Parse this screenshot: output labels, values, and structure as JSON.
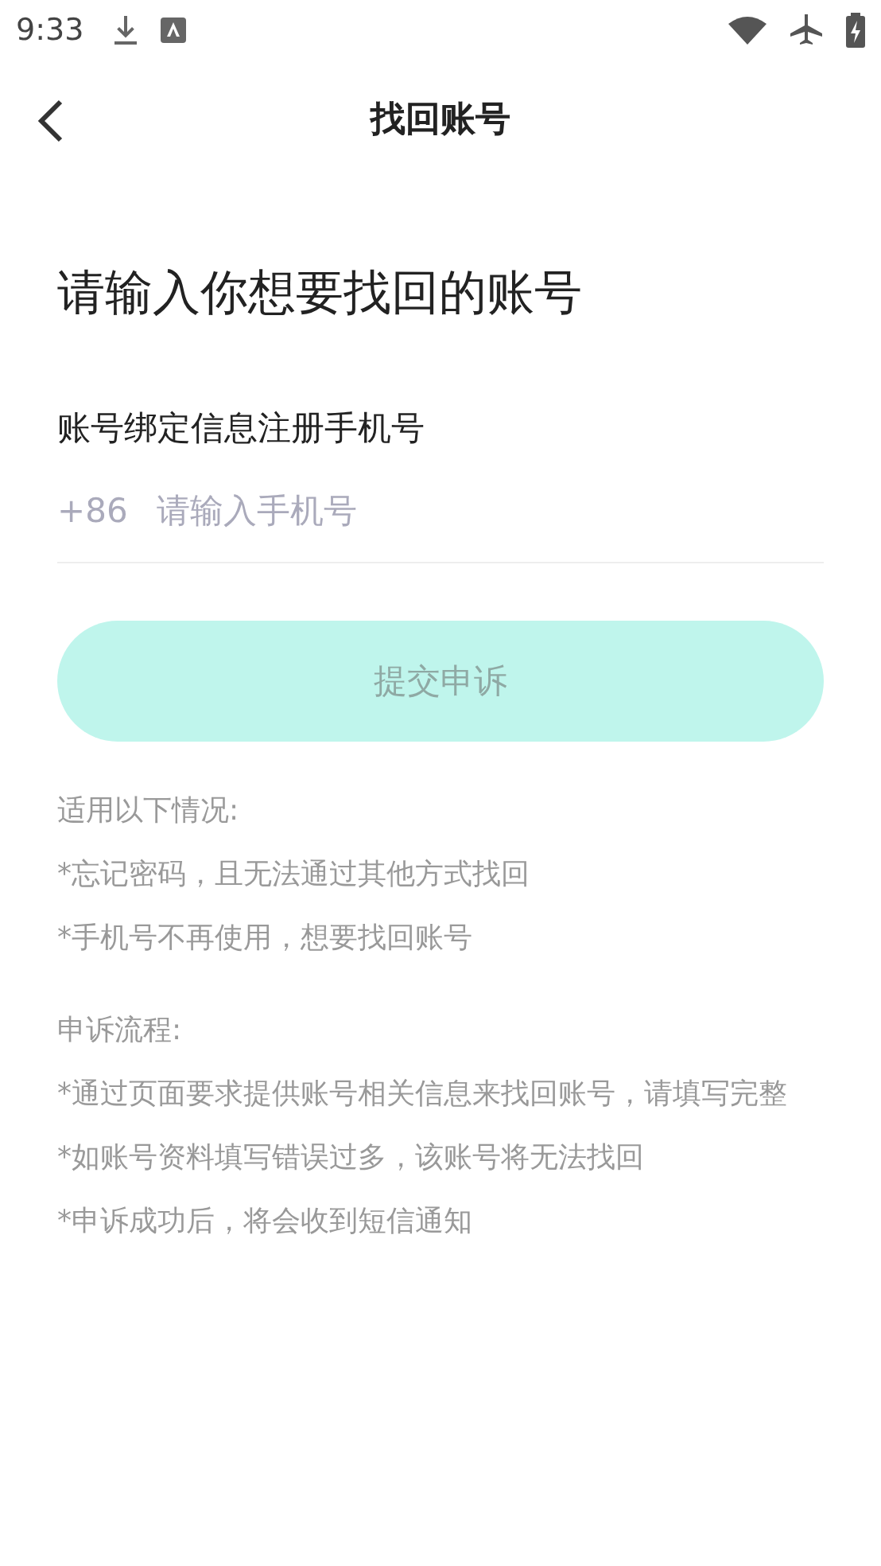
{
  "status_bar": {
    "time": "9:33"
  },
  "header": {
    "title": "找回账号"
  },
  "heading": "请输入你想要找回的账号",
  "phone_field": {
    "label": "账号绑定信息注册手机号",
    "country_code": "+86",
    "placeholder": "请输入手机号"
  },
  "submit_button": {
    "label": "提交申诉",
    "disabled": true
  },
  "notes": [
    {
      "title": "适用以下情况:",
      "items": [
        "*忘记密码，且无法通过其他方式找回",
        "*手机号不再使用，想要找回账号"
      ]
    },
    {
      "title": "申诉流程:",
      "items": [
        "*通过页面要求提供账号相关信息来找回账号，请填写完整",
        "*如账号资料填写错误过多，该账号将无法找回",
        "*申诉成功后，将会收到短信通知"
      ]
    }
  ]
}
